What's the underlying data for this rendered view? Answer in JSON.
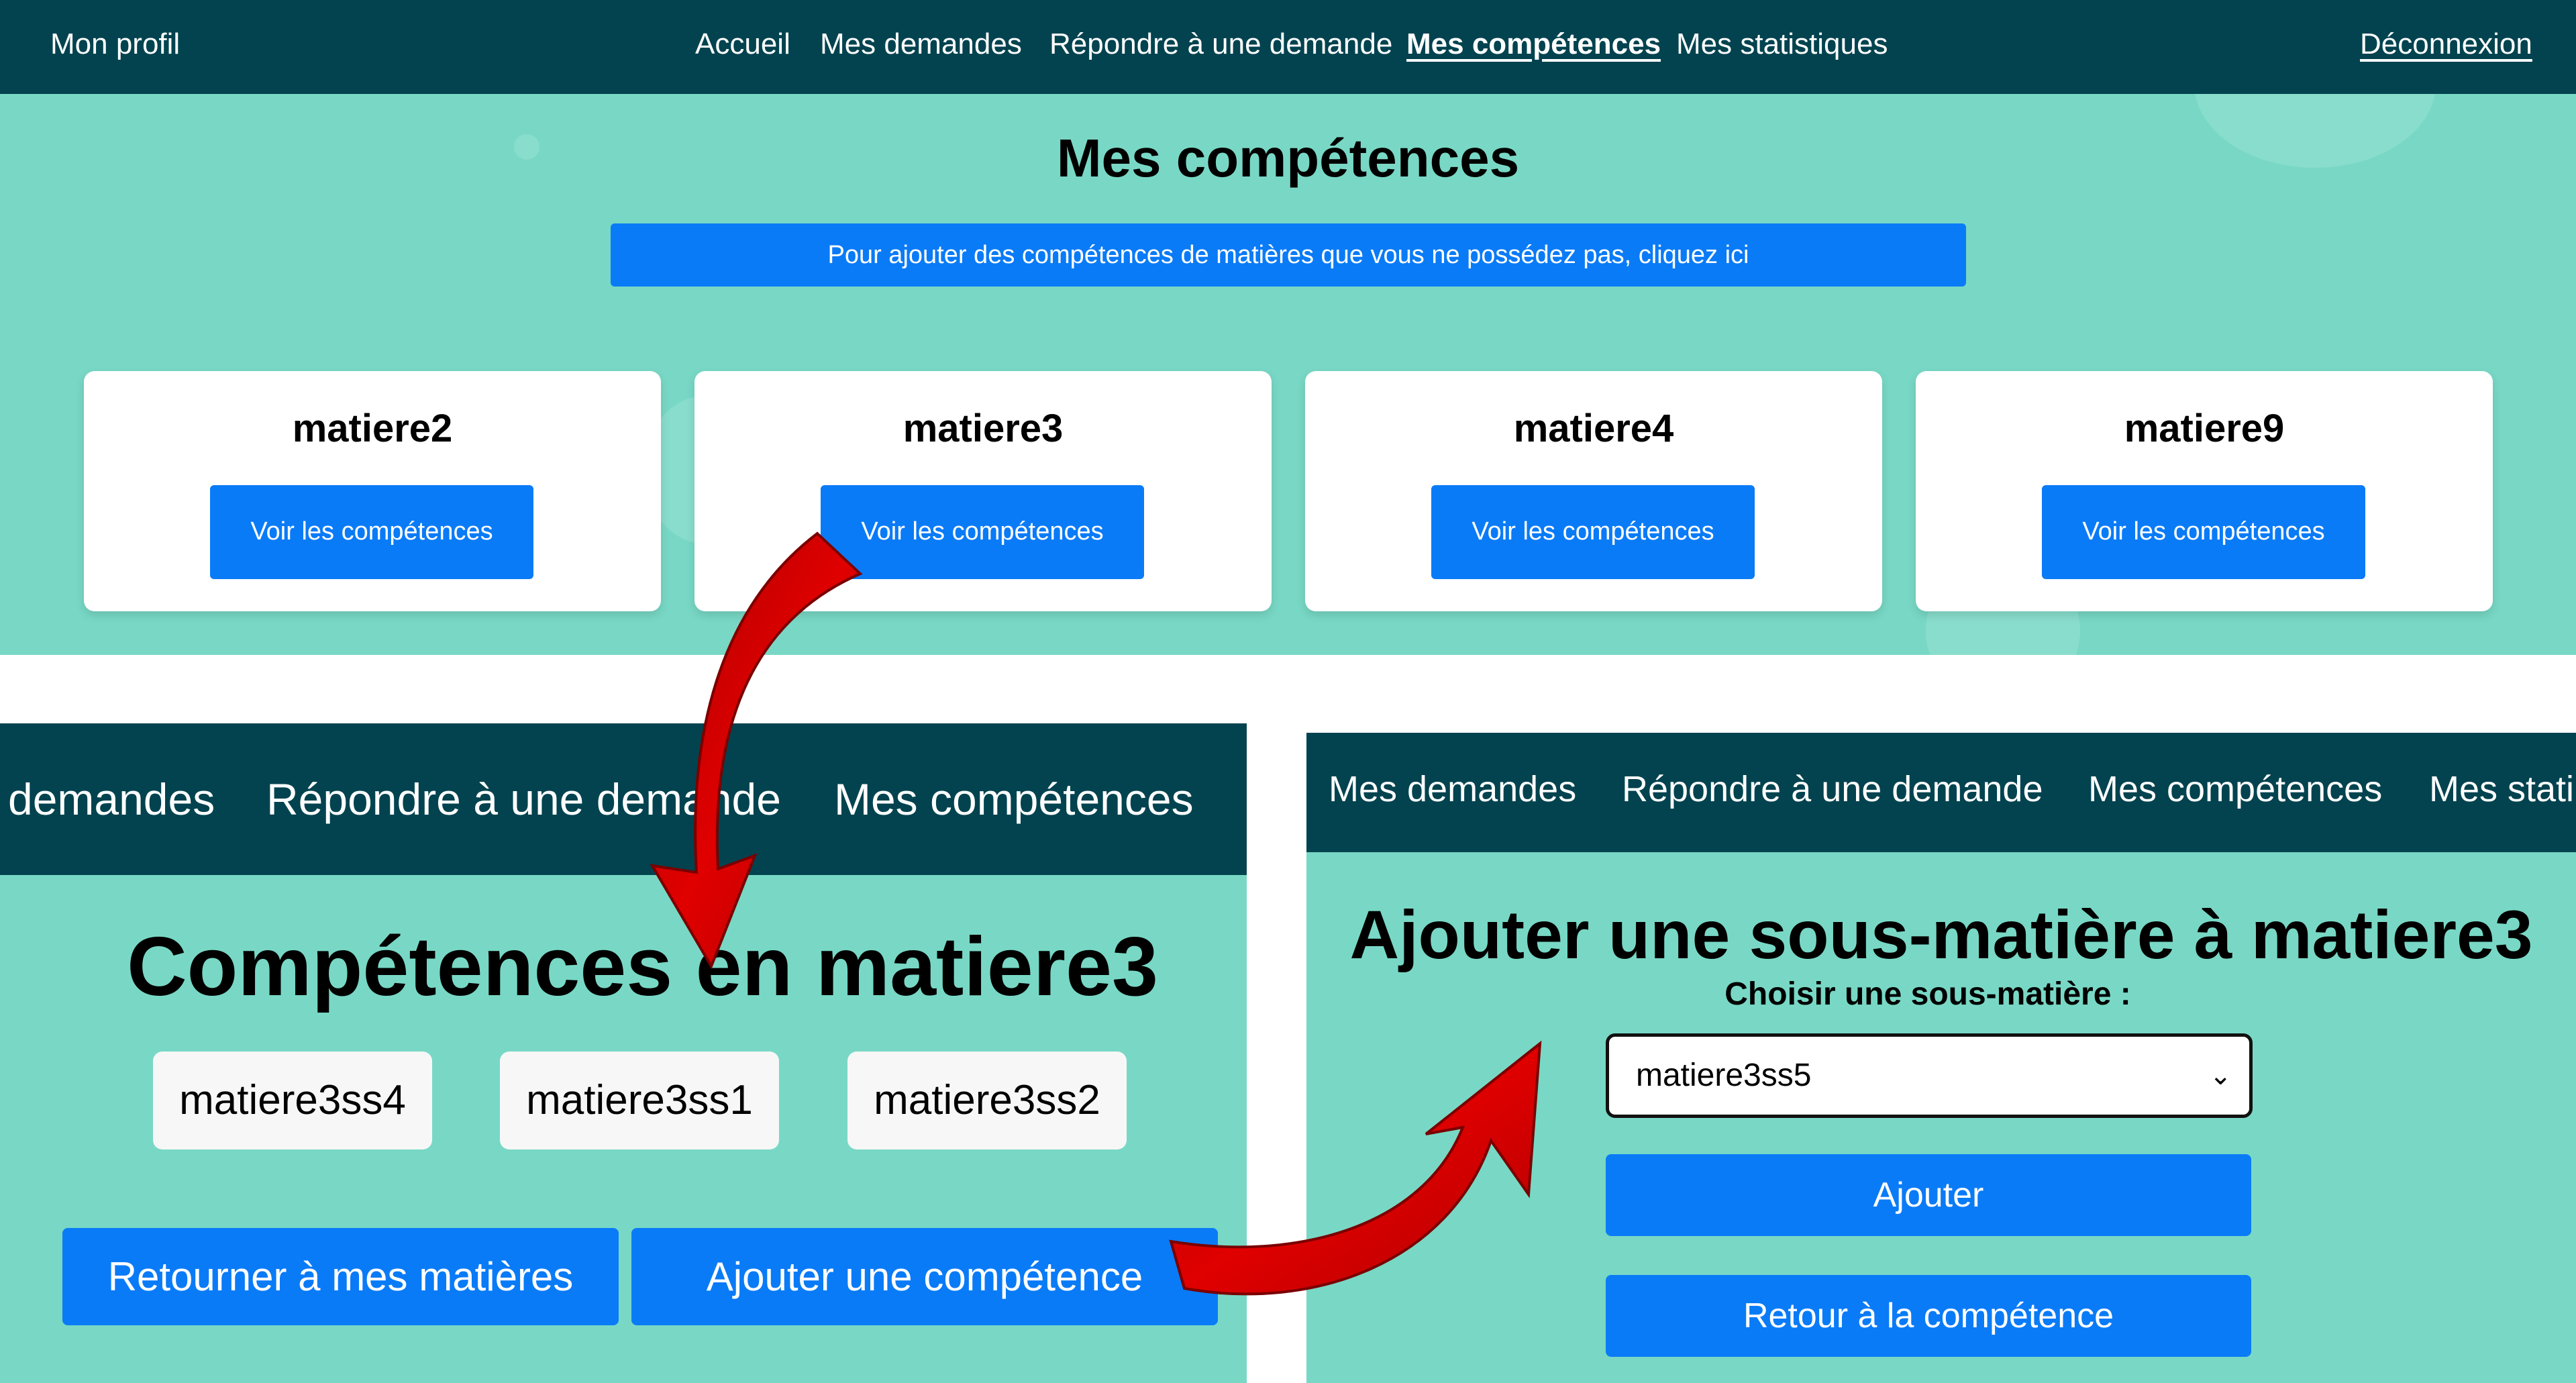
{
  "top": {
    "nav": {
      "profile": "Mon profil",
      "accueil": "Accueil",
      "demandes": "Mes demandes",
      "repondre": "Répondre à une demande",
      "competences": "Mes compétences",
      "statistiques": "Mes statistiques",
      "logout": "Déconnexion"
    },
    "title": "Mes compétences",
    "add_button": "Pour ajouter des compétences de matières que vous ne possédez pas, cliquez ici",
    "cards": [
      {
        "title": "matiere2",
        "button": "Voir les compétences"
      },
      {
        "title": "matiere3",
        "button": "Voir les compétences"
      },
      {
        "title": "matiere4",
        "button": "Voir les compétences"
      },
      {
        "title": "matiere9",
        "button": "Voir les compétences"
      }
    ]
  },
  "bottom_left": {
    "nav": {
      "demandes": "demandes",
      "repondre": "Répondre à une demande",
      "competences": "Mes compétences"
    },
    "title": "Compétences en matiere3",
    "chips": [
      "matiere3ss4",
      "matiere3ss1",
      "matiere3ss2"
    ],
    "back_button": "Retourner à mes matières",
    "add_button": "Ajouter une compétence"
  },
  "bottom_right": {
    "nav": {
      "demandes": "Mes demandes",
      "repondre": "Répondre à une demande",
      "competences": "Mes compétences",
      "statistiques": "Mes stati"
    },
    "title": "Ajouter une sous-matière à matiere3",
    "label": "Choisir une sous-matière :",
    "select_value": "matiere3ss5",
    "add_button": "Ajouter",
    "back_button": "Retour à la compétence"
  },
  "colors": {
    "nav_bg": "#02434f",
    "page_bg": "#78d8c5",
    "button": "#0a7bf7",
    "arrow": "#d40000"
  },
  "icons": [
    "chevron-down-icon",
    "curved-arrow-icon"
  ]
}
